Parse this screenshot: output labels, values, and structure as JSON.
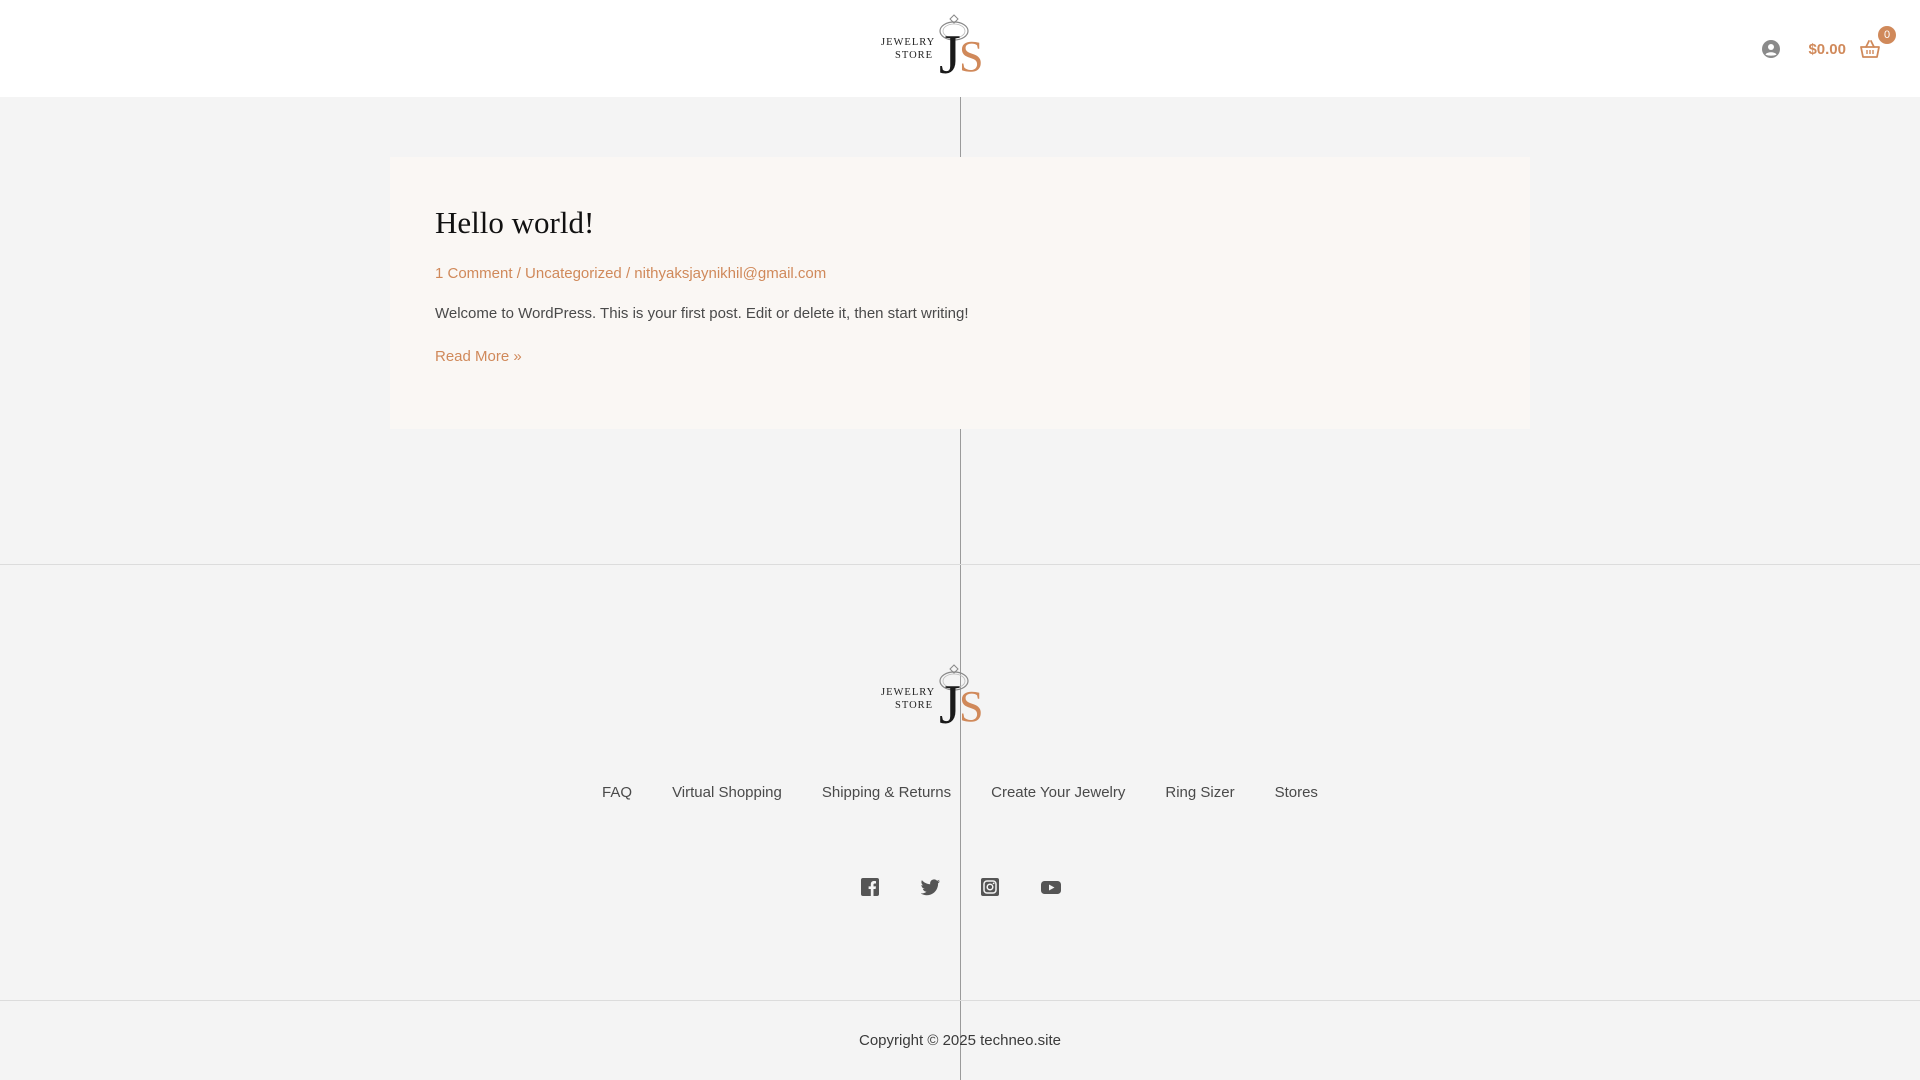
{
  "header": {
    "logo": {
      "line1": "JEWELRY",
      "line2": "STORE",
      "letter_j": "J",
      "letter_s": "S"
    },
    "cart_total": "$0.00",
    "cart_count": "0",
    "icons": {
      "account": "account-icon",
      "cart": "basket-icon"
    }
  },
  "post": {
    "title": "Hello world!",
    "meta": {
      "comments": "1 Comment",
      "category": "Uncategorized",
      "author": "nithyaksjaynikhil@gmail.com",
      "separator": " / "
    },
    "excerpt": "Welcome to WordPress. This is your first post. Edit or delete it, then start writing!",
    "read_more": "Read More »"
  },
  "footer": {
    "logo": {
      "line1": "JEWELRY",
      "line2": "STORE",
      "letter_j": "J",
      "letter_s": "S"
    },
    "nav": [
      {
        "label": "FAQ"
      },
      {
        "label": "Virtual Shopping"
      },
      {
        "label": "Shipping & Returns"
      },
      {
        "label": "Create Your Jewelry"
      },
      {
        "label": "Ring Sizer"
      },
      {
        "label": "Stores"
      }
    ],
    "social": [
      "facebook-icon",
      "twitter-icon",
      "instagram-icon",
      "youtube-icon"
    ],
    "copyright": "Copyright © 2025 techneo.site"
  },
  "colors": {
    "accent": "#d0895a",
    "background": "#f4f4f4",
    "card": "#faf7f4",
    "header": "#ffffff"
  }
}
